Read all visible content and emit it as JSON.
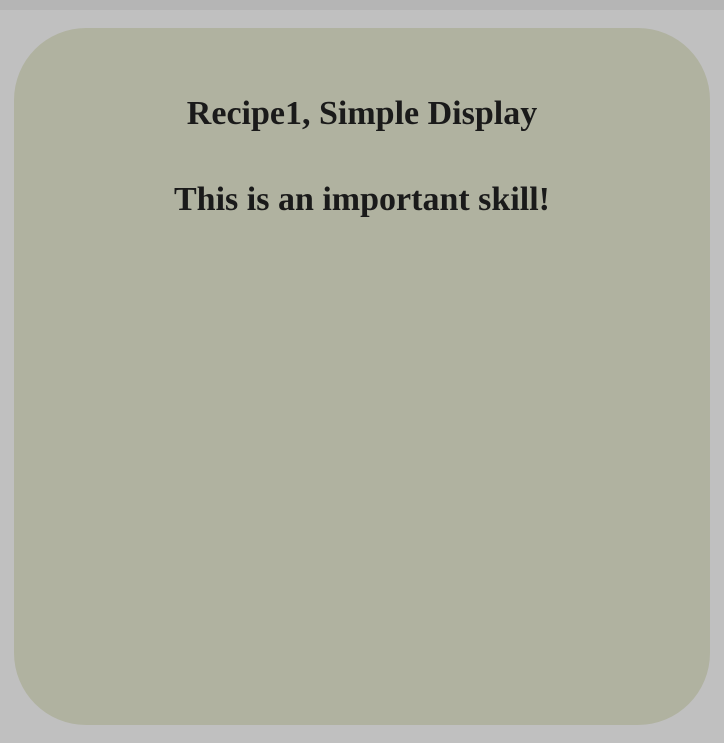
{
  "panel": {
    "heading": "Recipe1, Simple Display",
    "subheading": "This is an important skill!"
  },
  "colors": {
    "page_background": "#c0c0c0",
    "panel_background": "#b0b2a0",
    "text": "#1a1a1a"
  }
}
